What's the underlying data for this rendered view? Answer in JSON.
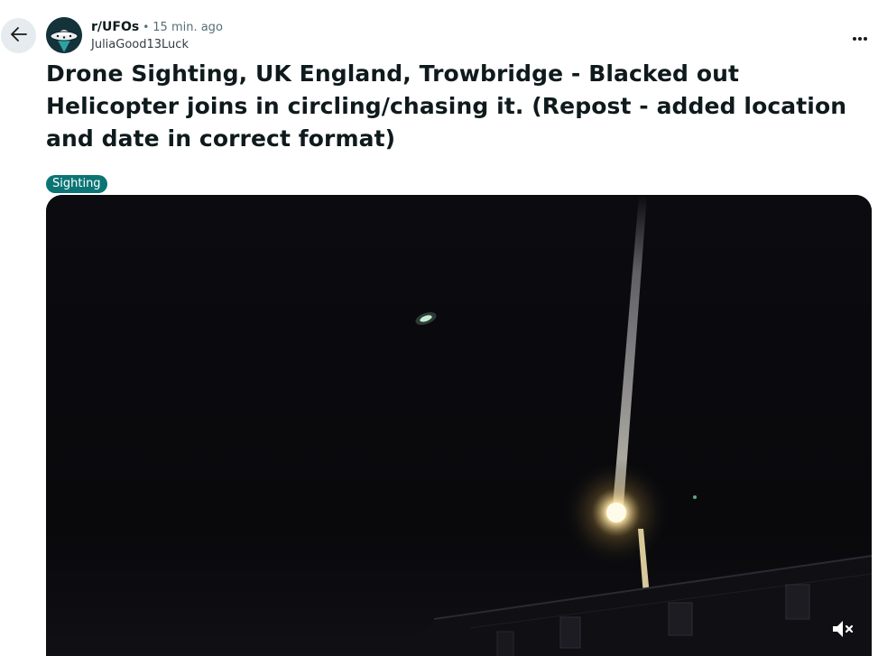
{
  "header": {
    "subreddit": "r/UFOs",
    "separator": "•",
    "time_ago": "15 min. ago",
    "author": "JuliaGood13Luck",
    "more_label": "..."
  },
  "post": {
    "title": "Drone Sighting, UK England, Trowbridge - Blacked out Helicopter joins in circling/chasing it. (Repost - added location and date in correct format)",
    "flair": "Sighting"
  },
  "icons": {
    "back": "arrow-left-icon",
    "more": "ellipsis-icon",
    "mute": "volume-muted-icon",
    "avatar": "ufo-avatar-icon"
  },
  "colors": {
    "flair_bg": "#0c7474",
    "back_bg": "#e5ebee",
    "video_bg": "#08080b",
    "streetlight": "#ffe7a8"
  }
}
